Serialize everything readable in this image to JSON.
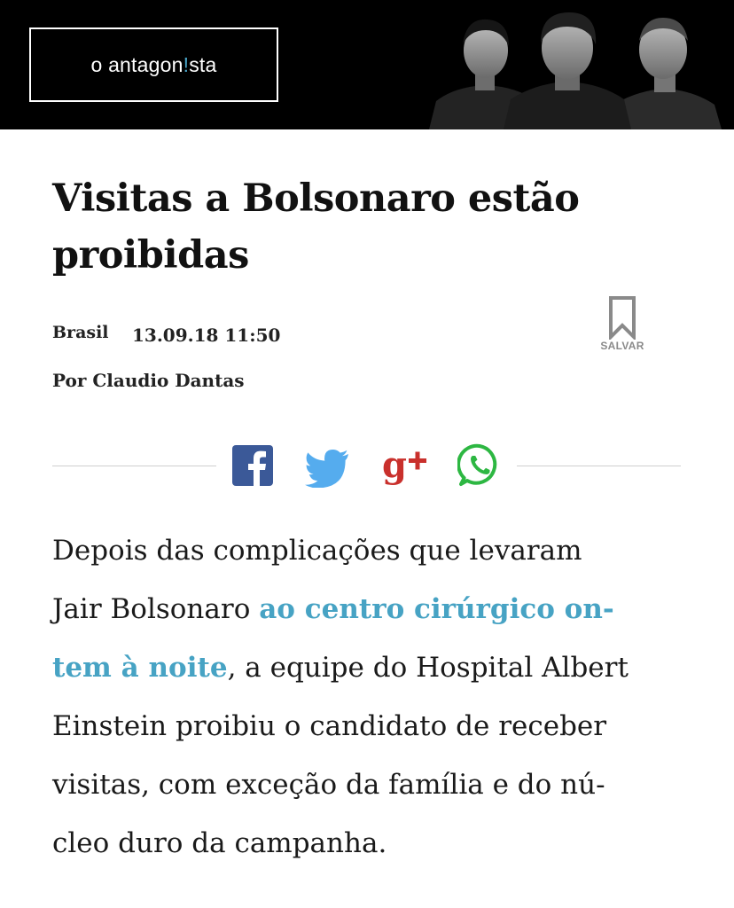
{
  "site": {
    "logo_prefix": "o antagon",
    "logo_mark": "!",
    "logo_suffix": "sta"
  },
  "article": {
    "title_line1": "Visitas a Bolsonaro estão",
    "title_line2": "proibidas",
    "category": "Brasil",
    "date": "13.09.18 11:50",
    "author": "Por Claudio Dantas",
    "save_label": "SALVAR",
    "body": {
      "l1": "Depois das complicações que levaram",
      "l2a": "Jair Bolsonaro ",
      "link_part1": "ao centro cirúrgico on-",
      "link_part2": "tem à noite",
      "l3b": ", a equipe do Hospital Albert",
      "l4": "Einstein proibiu o candidato de receber",
      "l5": "visitas, com exceção da família e do nú-",
      "l6": "cleo duro da campanha."
    }
  },
  "share": {
    "icons": [
      "facebook-icon",
      "twitter-icon",
      "google-plus-icon",
      "whatsapp-icon"
    ],
    "colors": {
      "facebook": "#3b5998",
      "twitter": "#55acee",
      "googleplus": "#c9302c",
      "whatsapp": "#2db742"
    }
  },
  "colors": {
    "accent": "#47a3c4",
    "header_bg": "#000000"
  }
}
